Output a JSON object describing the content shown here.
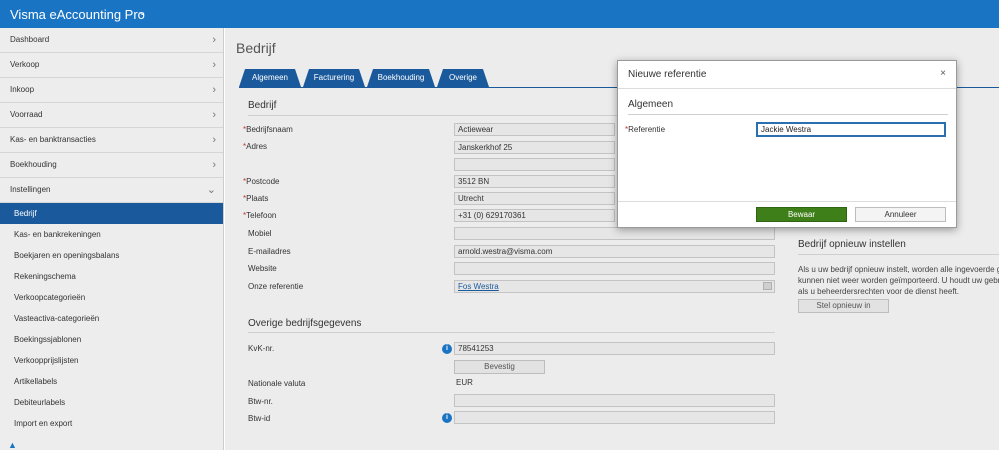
{
  "app": {
    "title": "Visma eAccounting Pro",
    "caret_icon": "chevron-down-icon"
  },
  "sidebar": {
    "items": [
      {
        "label": "Dashboard"
      },
      {
        "label": "Verkoop"
      },
      {
        "label": "Inkoop"
      },
      {
        "label": "Voorraad"
      },
      {
        "label": "Kas- en banktransacties"
      },
      {
        "label": "Boekhouding"
      },
      {
        "label": "Instellingen"
      }
    ],
    "subitems": [
      {
        "label": "Bedrijf"
      },
      {
        "label": "Kas- en bankrekeningen"
      },
      {
        "label": "Boekjaren en openingsbalans"
      },
      {
        "label": "Rekeningschema"
      },
      {
        "label": "Verkoopcategorieën"
      },
      {
        "label": "Vasteactiva-categorieën"
      },
      {
        "label": "Boekingssjablonen"
      },
      {
        "label": "Verkoopprijslijsten"
      },
      {
        "label": "Artikellabels"
      },
      {
        "label": "Debiteurlabels"
      },
      {
        "label": "Import en export"
      }
    ],
    "active_color": "#1a5a9c"
  },
  "page": {
    "title": "Bedrijf",
    "tabs": [
      {
        "label": "Algemeen"
      },
      {
        "label": "Facturering"
      },
      {
        "label": "Boekhouding"
      },
      {
        "label": "Overige"
      }
    ]
  },
  "form": {
    "section_title": "Bedrijf",
    "fields": {
      "bedrijfsnaam": {
        "label": "Bedrijfsnaam",
        "value": "Actiewear"
      },
      "adres": {
        "label": "Adres",
        "value": "Janskerkhof 25",
        "value2": ""
      },
      "postcode": {
        "label": "Postcode",
        "value": "3512 BN"
      },
      "plaats": {
        "label": "Plaats",
        "value": "Utrecht"
      },
      "telefoon": {
        "label": "Telefoon",
        "value": "+31 (0) 629170361"
      },
      "mobiel": {
        "label": "Mobiel",
        "value": ""
      },
      "email": {
        "label": "E-mailadres",
        "value": "arnold.westra@visma.com"
      },
      "website": {
        "label": "Website",
        "value": ""
      },
      "referentie": {
        "label": "Onze referentie",
        "value": "Fos Westra"
      }
    },
    "required_mark": "*"
  },
  "other": {
    "section_title": "Overige bedrijfsgegevens",
    "kvk": {
      "label": "KvK-nr.",
      "value": "78541253"
    },
    "bevestig_label": "Bevestig",
    "valuta": {
      "label": "Nationale valuta",
      "value": "EUR"
    },
    "btw_nr": {
      "label": "Btw-nr.",
      "value": ""
    },
    "btw_id": {
      "label": "Btw-id",
      "value": ""
    },
    "info_icon": "i"
  },
  "reset": {
    "title": "Bedrijf opnieuw instellen",
    "line1": "Als u uw bedrijf opnieuw instelt, worden alle ingevoerde ge",
    "line2": "kunnen niet weer worden geïmporteerd. U houdt uw gebrui",
    "line3": "als u beheerdersrechten voor de dienst heeft.",
    "button": "Stel opnieuw in"
  },
  "dialog": {
    "title": "Nieuwe referentie",
    "close": "×",
    "section": "Algemeen",
    "label": "Referentie",
    "value": "Jackie Westra",
    "save": "Bewaar",
    "cancel": "Annuleer"
  }
}
